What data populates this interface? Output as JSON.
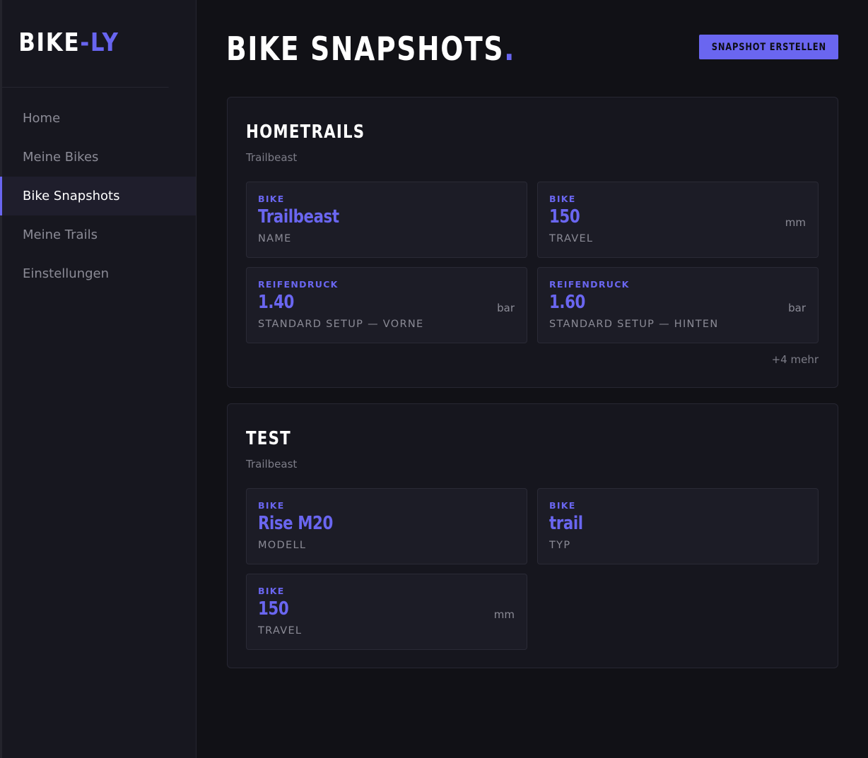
{
  "sidebar": {
    "brand_main": "BIKE",
    "brand_accent": "-LY",
    "items": [
      {
        "label": "Home"
      },
      {
        "label": "Meine Bikes"
      },
      {
        "label": "Bike Snapshots"
      },
      {
        "label": "Meine Trails"
      },
      {
        "label": "Einstellungen"
      }
    ],
    "active_index": 2
  },
  "header": {
    "title": "BIKE SNAPSHOTS",
    "title_dot": ".",
    "create_button": "SNAPSHOT ERSTELLEN"
  },
  "snapshots": [
    {
      "title": "HOMETRAILS",
      "bike": "Trailbeast",
      "tiles": [
        {
          "category": "BIKE",
          "value": "Trailbeast",
          "unit": "",
          "label": "NAME"
        },
        {
          "category": "BIKE",
          "value": "150",
          "unit": "mm",
          "label": "TRAVEL"
        },
        {
          "category": "REIFENDRUCK",
          "value": "1.40",
          "unit": "bar",
          "label": "STANDARD SETUP — VORNE"
        },
        {
          "category": "REIFENDRUCK",
          "value": "1.60",
          "unit": "bar",
          "label": "STANDARD SETUP — HINTEN"
        }
      ],
      "more": "+4 mehr"
    },
    {
      "title": "TEST",
      "bike": "Trailbeast",
      "tiles": [
        {
          "category": "BIKE",
          "value": "Rise M20",
          "unit": "",
          "label": "MODELL"
        },
        {
          "category": "BIKE",
          "value": "trail",
          "unit": "",
          "label": "TYP"
        },
        {
          "category": "BIKE",
          "value": "150",
          "unit": "mm",
          "label": "TRAVEL"
        }
      ]
    }
  ],
  "colors": {
    "accent": "#6a66f0",
    "background": "#111116",
    "sidebar": "#17171f",
    "card": "#16161e",
    "tile": "#1c1c26"
  }
}
